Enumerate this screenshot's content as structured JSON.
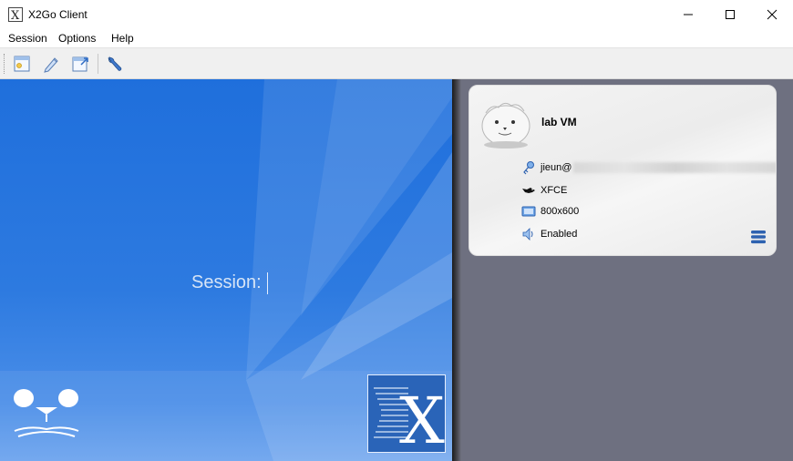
{
  "window": {
    "title": "X2Go Client"
  },
  "menubar": {
    "items": [
      "Session",
      "Options",
      "Help"
    ]
  },
  "toolbar": {
    "buttons": [
      "new-session-icon",
      "edit-session-icon",
      "export-session-icon",
      "settings-icon"
    ]
  },
  "login": {
    "prompt": "Session:",
    "input_value": ""
  },
  "session_card": {
    "name": "lab VM",
    "user_prefix": "jieun@",
    "desktop": "XFCE",
    "resolution": "800x600",
    "sound": "Enabled"
  },
  "colors": {
    "accent": "#1f6fdc",
    "right_pane": "#6e7080"
  }
}
